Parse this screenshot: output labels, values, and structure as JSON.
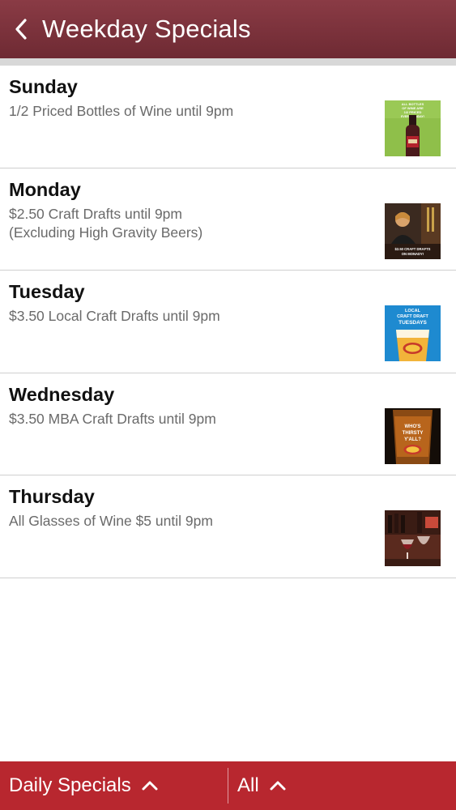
{
  "header": {
    "title": "Weekday Specials",
    "background": "#7a313b"
  },
  "specials": [
    {
      "day": "Sunday",
      "description": "1/2 Priced Bottles of Wine until 9pm",
      "image_icon": "wine-bottle-promo",
      "image_text": "ALL BOTTLES OF WINE ARE 1/2 PRICED EVERY SUNDAY!"
    },
    {
      "day": "Monday",
      "description": "$2.50 Craft Drafts until 9pm\n(Excluding High Gravity Beers)",
      "image_icon": "bartender-promo",
      "image_text": "$2.50 CRAFT DRAFTS ON MONDAY!"
    },
    {
      "day": "Tuesday",
      "description": "$3.50 Local Craft Drafts until 9pm",
      "image_icon": "beer-glass-promo",
      "image_text": "LOCAL CRAFT DRAFT TUESDAYS"
    },
    {
      "day": "Wednesday",
      "description": "$3.50 MBA Craft Drafts until 9pm",
      "image_icon": "beer-pint-promo",
      "image_text": "WHO'S THIRSTY Y'ALL?"
    },
    {
      "day": "Thursday",
      "description": "All Glasses of Wine $5 until 9pm",
      "image_icon": "wine-glasses-promo",
      "image_text": ""
    }
  ],
  "footer": {
    "left_label": "Daily Specials",
    "right_label": "All",
    "background": "#b8272f"
  }
}
